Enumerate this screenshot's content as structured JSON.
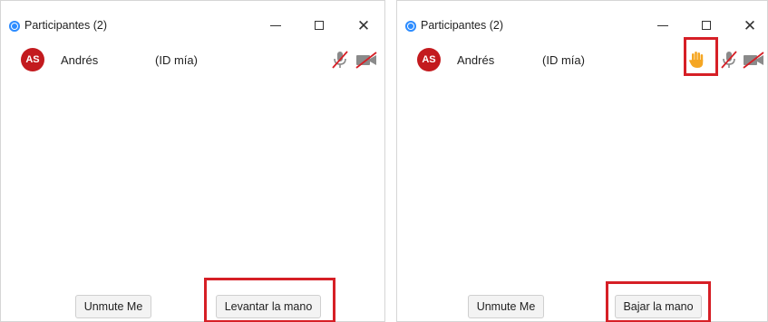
{
  "windows": [
    {
      "title": "Participantes (2)",
      "participant": {
        "initials": "AS",
        "name": "Andrés",
        "id_label": "(ID mía)"
      },
      "buttons": {
        "unmute": "Unmute Me",
        "hand": "Levantar la mano"
      },
      "hand_raised": false
    },
    {
      "title": "Participantes (2)",
      "participant": {
        "initials": "AS",
        "name": "Andrés",
        "id_label": "(ID mía)"
      },
      "buttons": {
        "unmute": "Unmute Me",
        "hand": "Bajar la mano"
      },
      "hand_raised": true
    }
  ],
  "icons": {
    "app": "zoom-app-icon",
    "minimize": "minimize-icon",
    "maximize": "maximize-icon",
    "close": "close-icon",
    "mic": "mic-muted-icon",
    "video": "video-off-icon",
    "hand": "raised-hand-icon"
  },
  "colors": {
    "avatar": "#c31a1e",
    "highlight": "#d61f26",
    "hand": "#f5a623",
    "muted_slash": "#d61f26",
    "app_icon": "#2d8cff"
  }
}
